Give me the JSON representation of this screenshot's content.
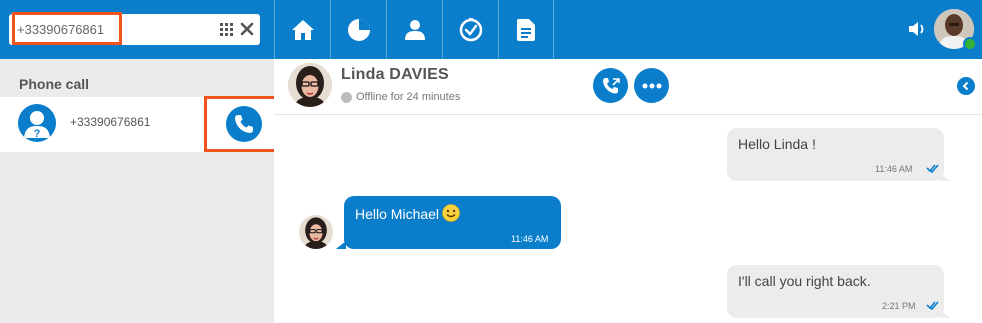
{
  "search": {
    "value": "+33390676861",
    "placeholder": ""
  },
  "nav": {
    "items": [
      {
        "icon": "home-icon"
      },
      {
        "icon": "recent-icon"
      },
      {
        "icon": "contacts-icon"
      },
      {
        "icon": "clock-icon"
      },
      {
        "icon": "document-icon"
      }
    ]
  },
  "header_right": {
    "volume_icon": "volume-icon",
    "presence": "online"
  },
  "left_panel": {
    "section_title": "Phone call",
    "call_item": {
      "number": "+33390676861"
    }
  },
  "chat": {
    "contact_name": "Linda DAVIES",
    "status_text": "Offline for 24 minutes"
  },
  "messages": [
    {
      "direction": "out",
      "text": "Hello Linda !",
      "time": "11:46 AM"
    },
    {
      "direction": "in",
      "text": "Hello Michael",
      "emoji": "smiley",
      "time": "11:46 AM"
    },
    {
      "direction": "out",
      "text": "I'll call you right back.",
      "time": "2:21 PM"
    }
  ],
  "colors": {
    "accent": "#0a7ecb",
    "highlight": "#f0531c",
    "presence_online": "#34b233",
    "presence_offline": "#bdbdbd"
  }
}
